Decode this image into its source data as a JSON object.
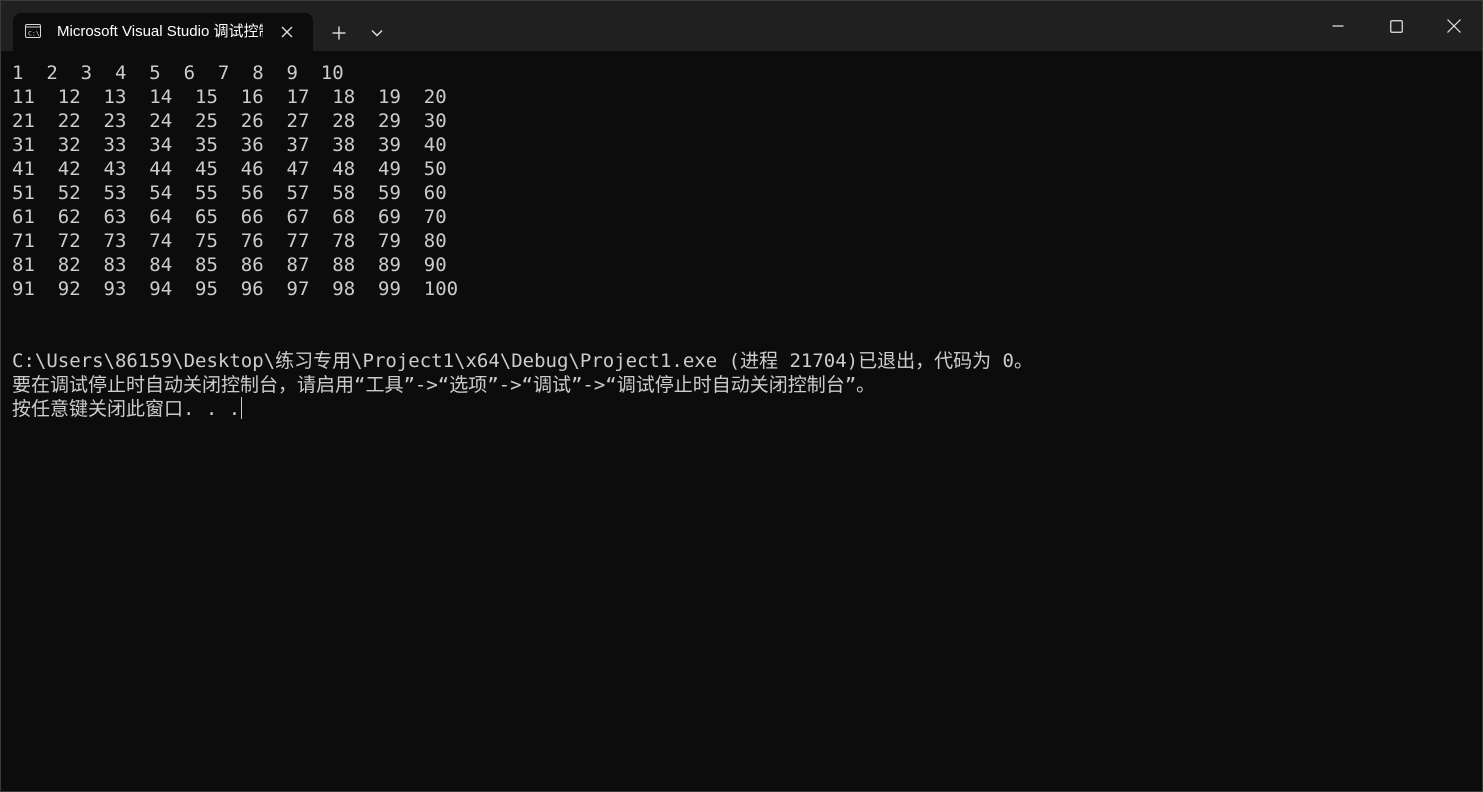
{
  "tab": {
    "title": "Microsoft Visual Studio 调试控制台",
    "icon": "terminal-icon",
    "close_icon": "close-icon"
  },
  "titlebar": {
    "new_tab_icon": "plus-icon",
    "dropdown_icon": "chevron-down-icon",
    "minimize_icon": "minimize-icon",
    "maximize_icon": "maximize-icon",
    "close_icon": "close-icon"
  },
  "console": {
    "lines": [
      "1  2  3  4  5  6  7  8  9  10",
      "11  12  13  14  15  16  17  18  19  20",
      "21  22  23  24  25  26  27  28  29  30",
      "31  32  33  34  35  36  37  38  39  40",
      "41  42  43  44  45  46  47  48  49  50",
      "51  52  53  54  55  56  57  58  59  60",
      "61  62  63  64  65  66  67  68  69  70",
      "71  72  73  74  75  76  77  78  79  80",
      "81  82  83  84  85  86  87  88  89  90",
      "91  92  93  94  95  96  97  98  99  100",
      "",
      "",
      "C:\\Users\\86159\\Desktop\\练习专用\\Project1\\x64\\Debug\\Project1.exe (进程 21704)已退出，代码为 0。",
      "要在调试停止时自动关闭控制台，请启用“工具”->“选项”->“调试”->“调试停止时自动关闭控制台”。",
      "按任意键关闭此窗口. . ."
    ]
  },
  "colors": {
    "background": "#0c0c0c",
    "titlebar": "#202020",
    "text": "#cccccc"
  }
}
